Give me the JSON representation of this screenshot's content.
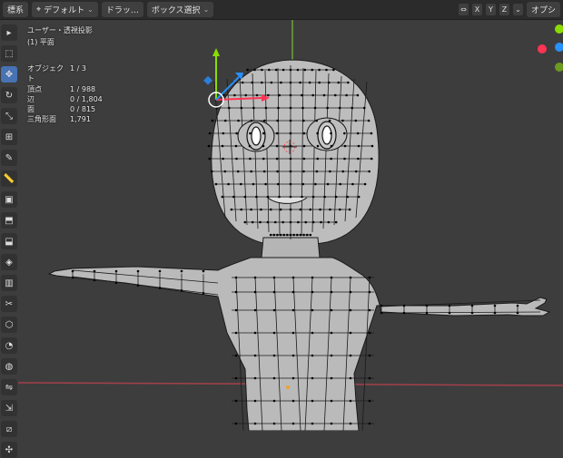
{
  "header": {
    "snap_menu": "標系",
    "orientation": "デフォルト",
    "drag_label": "ドラッ…",
    "select_mode": "ボックス選択",
    "axis_labels": [
      "X",
      "Y",
      "Z"
    ],
    "options_label": "オプシ"
  },
  "viewport": {
    "view_name": "ユーザー・透視投影",
    "collection_name": "(1) 平面",
    "stats": [
      {
        "label": "オブジェクト",
        "value": "1 / 3"
      },
      {
        "label": "頂点",
        "value": "1 / 988"
      },
      {
        "label": "辺",
        "value": "0 / 1,804"
      },
      {
        "label": "面",
        "value": "0 / 815"
      },
      {
        "label": "三角形面",
        "value": "1,791"
      }
    ]
  },
  "toolbar": {
    "tools": [
      "cursor-tool",
      "select-box-tool",
      "move-tool",
      "rotate-tool",
      "scale-tool",
      "transform-tool",
      "annotate-tool",
      "measure-tool",
      "add-cube-tool",
      "extrude-tool",
      "inset-tool",
      "bevel-tool",
      "loop-cut-tool",
      "knife-tool",
      "poly-build-tool",
      "spin-tool",
      "smooth-tool",
      "edge-slide-tool",
      "shrink-fatten-tool",
      "shear-tool",
      "rip-tool"
    ],
    "active_tool": "move-tool"
  },
  "colors": {
    "viewport_bg": "#3d3d3d",
    "mesh_face": "#bdbdbd",
    "mesh_edge": "#1a1a1a",
    "x_axis": "#ff3352",
    "y_axis": "#8bdc00",
    "z_axis": "#2890ff",
    "active_blue": "#4772b3"
  }
}
